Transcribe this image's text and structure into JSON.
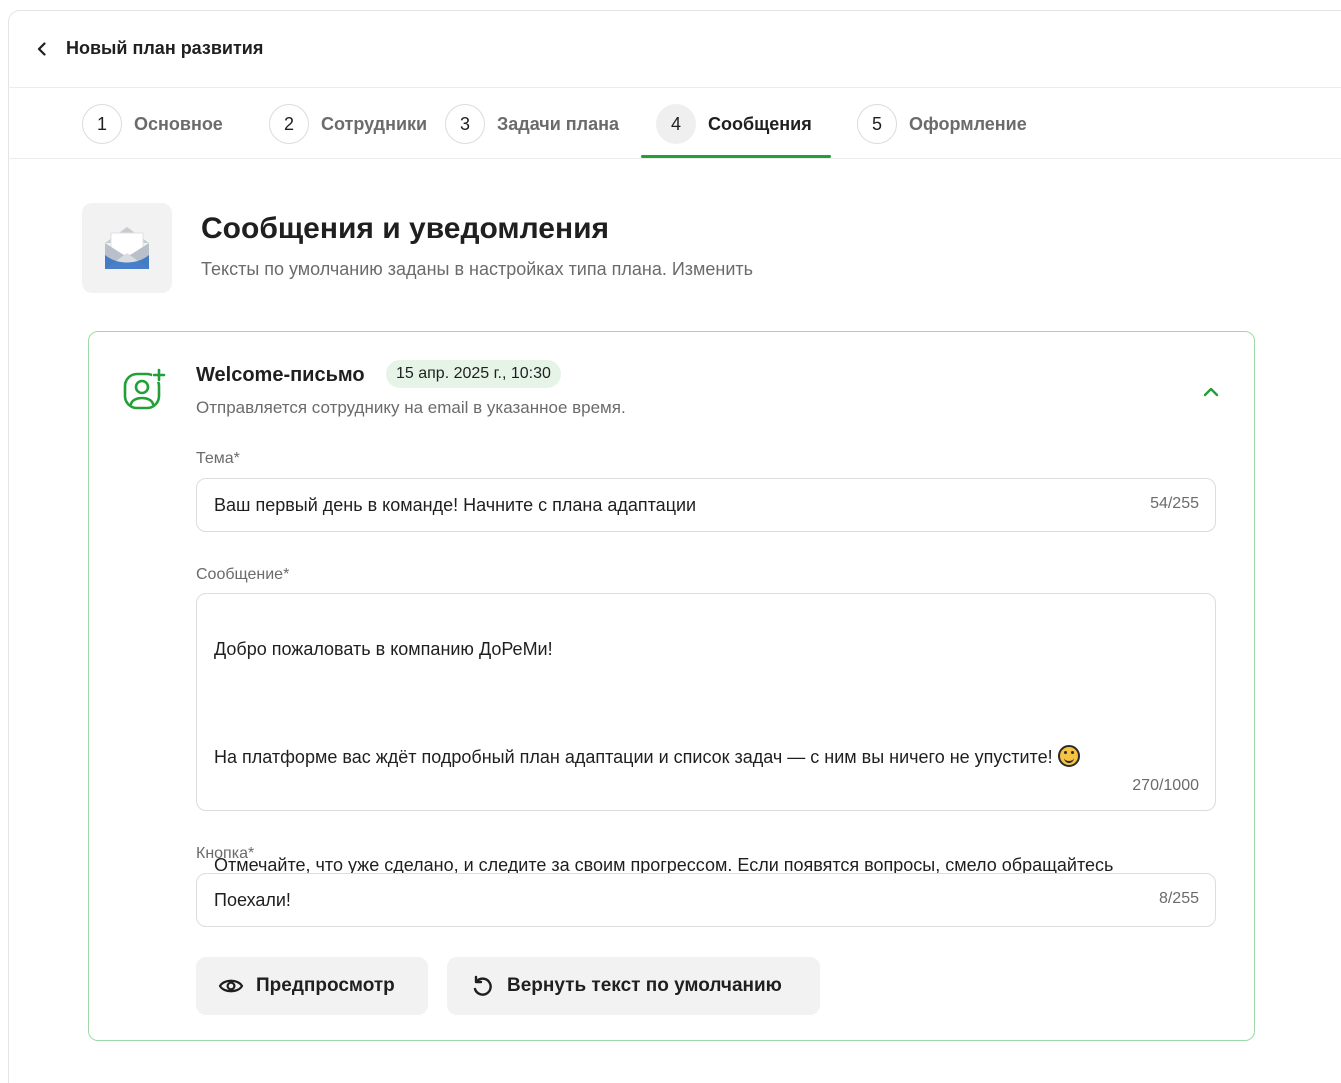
{
  "header": {
    "title": "Новый план развития"
  },
  "tabs": [
    {
      "num": "1",
      "label": "Основное"
    },
    {
      "num": "2",
      "label": "Сотрудники"
    },
    {
      "num": "3",
      "label": "Задачи плана"
    },
    {
      "num": "4",
      "label": "Сообщения",
      "active": true
    },
    {
      "num": "5",
      "label": "Оформление"
    }
  ],
  "section": {
    "title": "Сообщения и уведомления",
    "subtitle": "Тексты по умолчанию заданы в настройках типа плана.",
    "subtitle_link": "Изменить"
  },
  "card": {
    "title": "Welcome-письмо",
    "date": "15 апр. 2025 г., 10:30",
    "description": "Отправляется сотруднику на email в указанное время.",
    "subject": {
      "label": "Тема*",
      "value": "Ваш первый день в команде! Начните с плана адаптации",
      "counter": "54/255"
    },
    "message": {
      "label": "Сообщение*",
      "line1": "Добро пожаловать в компанию ДоРеМи!",
      "line2": "На платформе вас ждёт подробный план адаптации и список задач — с ним вы ничего не упустите!",
      "line3": "Отмечайте, что уже сделано, и следите за своим прогрессом. Если появятся вопросы, смело обращайтесь к наставнику — он всегда поможет.",
      "counter": "270/1000"
    },
    "button_field": {
      "label": "Кнопка*",
      "value": "Поехали!",
      "counter": "8/255"
    },
    "actions": {
      "preview": "Предпросмотр",
      "reset": "Вернуть текст по умолчанию"
    }
  },
  "colors": {
    "accent": "#21a038",
    "card_border": "#9fd9a9",
    "badge_bg": "#e6f4e8"
  }
}
